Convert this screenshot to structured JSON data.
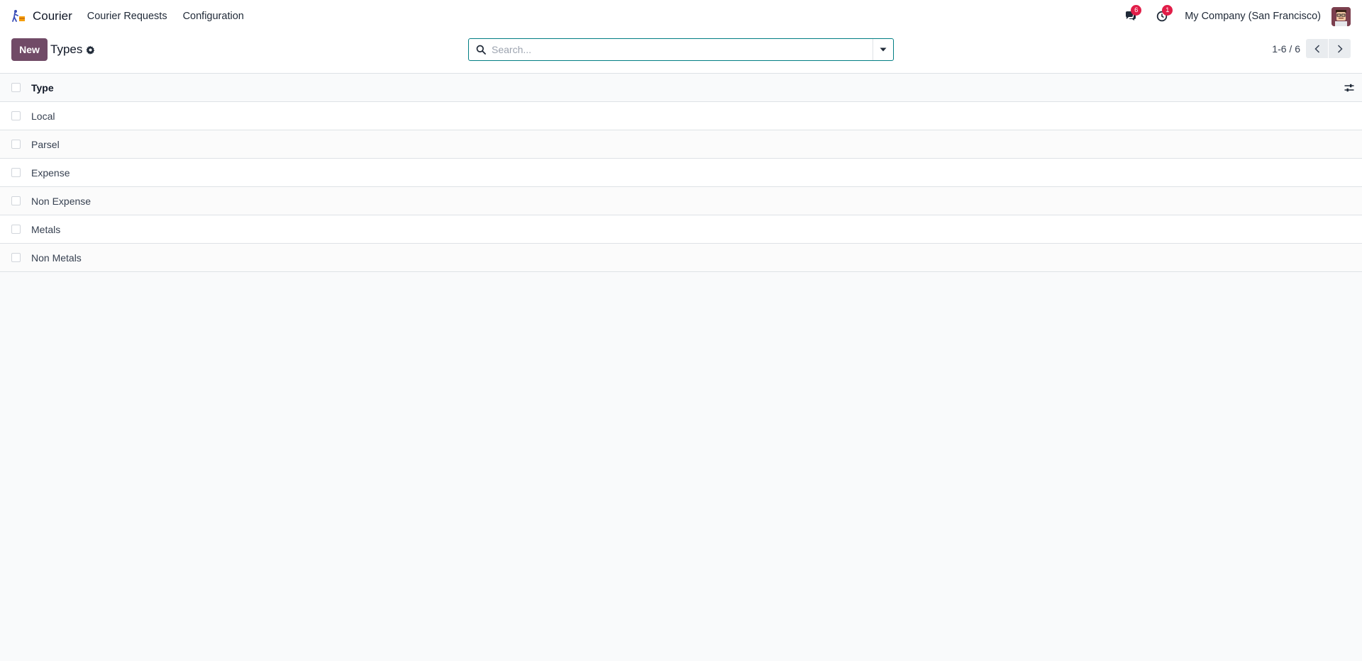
{
  "navbar": {
    "app_name": "Courier",
    "menu": [
      "Courier Requests",
      "Configuration"
    ],
    "messages_count": "6",
    "activities_count": "1",
    "company": "My Company (San Francisco)"
  },
  "control_panel": {
    "new_label": "New",
    "title": "Types",
    "search_placeholder": "Search...",
    "pager": "1-6 / 6"
  },
  "table": {
    "header": "Type",
    "rows": [
      "Local",
      "Parsel",
      "Expense",
      "Non Expense",
      "Metals",
      "Non Metals"
    ]
  },
  "colors": {
    "brand": "#714b67",
    "accent": "#017e84",
    "badge": "#e11d48"
  }
}
